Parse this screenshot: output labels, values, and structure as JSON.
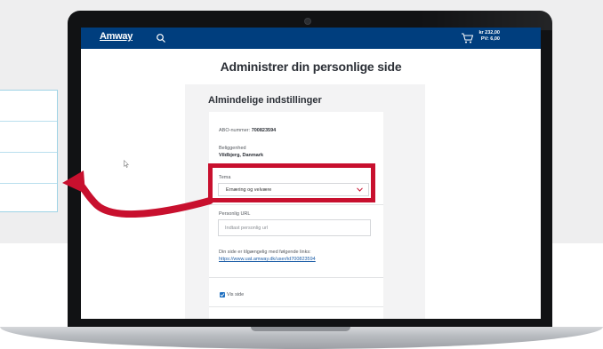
{
  "header": {
    "logo": "Amway",
    "cart_amount": "kr 232,00",
    "cart_pv": "PV: 6,00"
  },
  "page": {
    "title": "Administrer din personlige side",
    "section_title": "Almindelige indstillinger"
  },
  "settings": {
    "abo_label": "ABO-nummer:",
    "abo_value": "700823594",
    "location_label": "Beliggenhed",
    "location_value": "Vildbjerg, Danmark",
    "theme_label": "Tema",
    "theme_value": "Ernæring og velvære",
    "url_label": "Personlig URL",
    "url_placeholder": "Indtast personlig url",
    "links_text": "Din side er tilgængelig med følgende links:",
    "link_url": "https://www.uat.amway.dk/user/id700823594",
    "show_page_label": "Vis side",
    "show_page_checked": true
  },
  "colors": {
    "nav": "#003e7e",
    "highlight": "#c8102e",
    "arrow": "#c8102e"
  }
}
